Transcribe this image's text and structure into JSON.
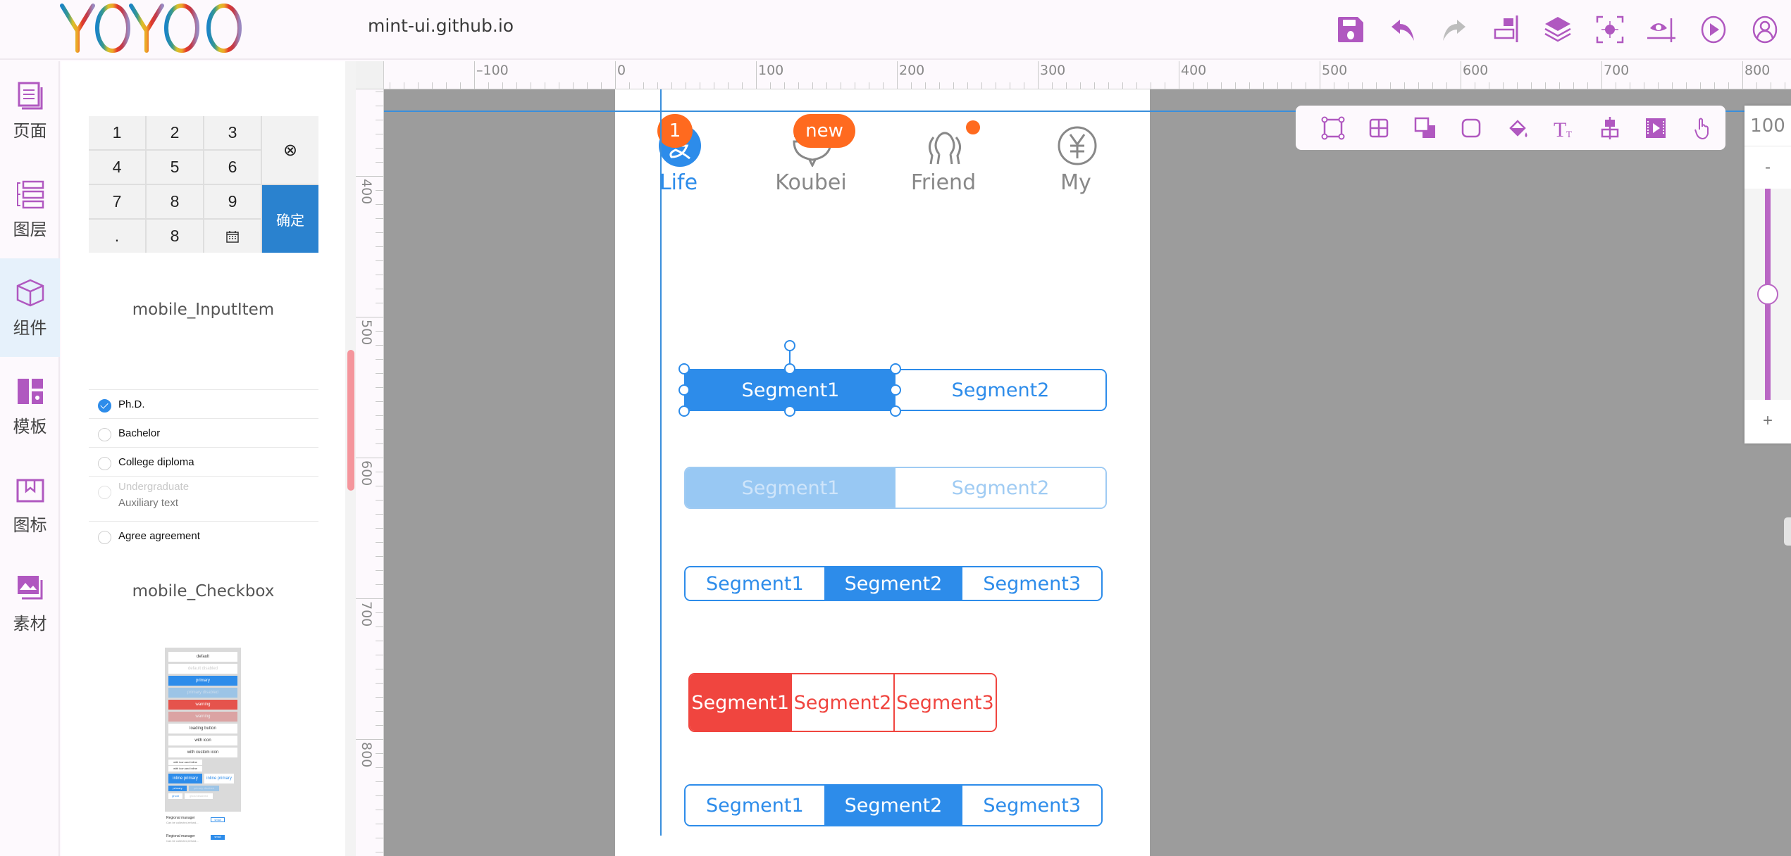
{
  "app": {
    "logo_text": "YOYOO",
    "site_title": "mint-ui.github.io"
  },
  "toolbar": {
    "items": [
      {
        "name": "save",
        "icon": "save-icon",
        "enabled": true
      },
      {
        "name": "undo",
        "icon": "undo-icon",
        "enabled": true
      },
      {
        "name": "redo",
        "icon": "redo-icon",
        "enabled": false
      },
      {
        "name": "align-right",
        "icon": "align-right-icon",
        "enabled": true
      },
      {
        "name": "layers",
        "icon": "layers-icon",
        "enabled": true
      },
      {
        "name": "focus",
        "icon": "focus-icon",
        "enabled": true
      },
      {
        "name": "preview-guide",
        "icon": "eye-icon",
        "enabled": true
      },
      {
        "name": "play",
        "icon": "play-icon",
        "enabled": true
      },
      {
        "name": "user",
        "icon": "user-icon",
        "enabled": true
      }
    ]
  },
  "leftnav": {
    "items": [
      {
        "label": "页面",
        "icon": "page-icon",
        "active": false
      },
      {
        "label": "图层",
        "icon": "layers-list-icon",
        "active": false
      },
      {
        "label": "组件",
        "icon": "component-cube-icon",
        "active": true
      },
      {
        "label": "模板",
        "icon": "template-icon",
        "active": false
      },
      {
        "label": "图标",
        "icon": "icon-library-icon",
        "active": false
      },
      {
        "label": "素材",
        "icon": "assets-image-icon",
        "active": false
      }
    ]
  },
  "panel": {
    "keypad": {
      "keys": [
        "1",
        "2",
        "3",
        "4",
        "5",
        "6",
        "7",
        "8",
        "9",
        ".",
        "8"
      ],
      "calendar_icon": "calendar-icon",
      "delete_symbol": "⊗",
      "confirm_label": "确定"
    },
    "caption_inputitem": "mobile_InputItem",
    "radio_items": [
      {
        "label": "Ph.D.",
        "checked": true,
        "disabled": false
      },
      {
        "label": "Bachelor",
        "checked": false,
        "disabled": false
      },
      {
        "label": "College diploma",
        "checked": false,
        "disabled": false
      },
      {
        "label": "Undergraduate",
        "checked": false,
        "disabled": true,
        "aux": "Auxiliary text"
      },
      {
        "label": "Agree agreement",
        "checked": false,
        "disabled": false
      }
    ],
    "caption_checkbox": "mobile_Checkbox",
    "button_thumb": {
      "buttons": [
        "default",
        "default disabled",
        "primary",
        "primary disabled",
        "warning",
        "warning",
        "loading button",
        "with icon",
        "with custom icon",
        "with icon and inline",
        "with icon and inline",
        "inline primary",
        "inline primary",
        "primary",
        "primary disabled",
        "ghost",
        "ghost disabled"
      ],
      "list": [
        {
          "title": "Regional manager",
          "sub": "Can be collected,refund...",
          "action": "small"
        },
        {
          "title": "Regional manager",
          "sub": "Can be collected,refund...",
          "action": "small"
        }
      ]
    }
  },
  "rulers": {
    "horizontal_labels": [
      "-100",
      "0",
      "100",
      "200",
      "300",
      "400",
      "500",
      "600",
      "700",
      "800"
    ],
    "vertical_labels": [
      "400",
      "500",
      "600",
      "700",
      "800"
    ]
  },
  "artboard": {
    "tabbar": [
      {
        "label": "Life",
        "icon": "alipay-icon",
        "active": true,
        "badge": "1"
      },
      {
        "label": "Koubei",
        "icon": "koubei-bowl-icon",
        "active": false,
        "badge": "new"
      },
      {
        "label": "Friend",
        "icon": "friend-icon",
        "active": false,
        "dot": true
      },
      {
        "label": "My",
        "icon": "yen-circle-icon",
        "active": false
      }
    ],
    "segments": [
      {
        "variant": "default-selected",
        "items": [
          "Segment1",
          "Segment2"
        ],
        "active": 0
      },
      {
        "variant": "disabled",
        "items": [
          "Segment1",
          "Segment2"
        ],
        "active": 0
      },
      {
        "variant": "default",
        "items": [
          "Segment1",
          "Segment2",
          "Segment3"
        ],
        "active": 1
      },
      {
        "variant": "red",
        "items": [
          "Segment1",
          "Segment2",
          "Segment3"
        ],
        "active": 0
      },
      {
        "variant": "default",
        "items": [
          "Segment1",
          "Segment2",
          "Segment3"
        ],
        "active": 1
      }
    ]
  },
  "props_bar": {
    "items": [
      {
        "name": "transform",
        "icon": "transform-icon"
      },
      {
        "name": "grid",
        "icon": "grid-icon"
      },
      {
        "name": "shadow",
        "icon": "shadow-icon"
      },
      {
        "name": "radius",
        "icon": "radius-icon"
      },
      {
        "name": "fill",
        "icon": "paint-bucket-icon"
      },
      {
        "name": "text",
        "icon": "text-icon"
      },
      {
        "name": "align",
        "icon": "align-center-icon"
      },
      {
        "name": "media",
        "icon": "video-icon"
      },
      {
        "name": "interaction",
        "icon": "hand-pointer-icon"
      }
    ]
  },
  "zoom": {
    "value": "100",
    "minus": "-",
    "plus": "+",
    "slider_fraction": 0.5
  },
  "colors": {
    "accent": "#b966c4",
    "primary": "#2d8cea",
    "danger": "#f0453f",
    "badge": "#ff6a1f",
    "canvas": "#9c9c9c"
  }
}
